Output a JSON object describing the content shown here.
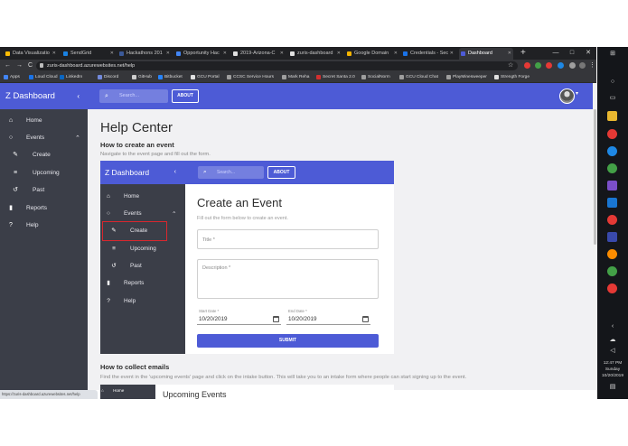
{
  "browser": {
    "tabs": [
      {
        "label": "Data Visualizatio",
        "color": "#fbbc04"
      },
      {
        "label": "SendGrid",
        "color": "#1a82e2"
      },
      {
        "label": "Hackathons 201",
        "color": "#3b5998"
      },
      {
        "label": "Opportunity Hac",
        "color": "#4285f4"
      },
      {
        "label": "2019-Arizona-C",
        "color": "#e0e0e0"
      },
      {
        "label": "zuris-dashboard",
        "color": "#e0e0e0"
      },
      {
        "label": "Google Domain",
        "color": "#f4b400"
      },
      {
        "label": "Credentials - Sec",
        "color": "#1a73e8"
      },
      {
        "label": "Dashboard",
        "color": "#4d5bd6"
      }
    ],
    "new_tab": "+",
    "window_controls": {
      "minimize": "—",
      "maximize": "□",
      "close": "✕"
    },
    "nav": {
      "back": "←",
      "forward": "→",
      "reload": "C"
    },
    "url": "zuris-dashboard.azurewebsites.net/help",
    "star": "☆",
    "menu": "⋮",
    "bookmarks": [
      {
        "label": "Apps",
        "color": "#4285f4"
      },
      {
        "label": "Loud Cloud",
        "color": "#1a73e8"
      },
      {
        "label": "LinkedIn",
        "color": "#0a66c2"
      },
      {
        "label": "Discord",
        "color": "#7289da"
      },
      {
        "label": "GitHub",
        "color": "#cccccc"
      },
      {
        "label": "Bitbucket",
        "color": "#2684ff"
      },
      {
        "label": "GCU Portal",
        "color": "#e0e0e0"
      },
      {
        "label": "CCSC Service Hours",
        "color": "#9e9e9e"
      },
      {
        "label": "Mark Reha",
        "color": "#9e9e9e"
      },
      {
        "label": "Secret Santa 2.0",
        "color": "#d32f2f"
      },
      {
        "label": "SocialNorm",
        "color": "#9e9e9e"
      },
      {
        "label": "GCU Cloud Chat",
        "color": "#9e9e9e"
      },
      {
        "label": "PlayMinesweeper",
        "color": "#9e9e9e"
      },
      {
        "label": "Strength Forge",
        "color": "#e0e0e0"
      }
    ],
    "status_url": "https://zuris-dashboard.azurewebsites.net/help"
  },
  "app": {
    "brand": "Z Dashboard",
    "collapse_icon": "‹",
    "search_placeholder": "Search...",
    "about_label": "ABOUT",
    "nav": [
      {
        "label": "Home",
        "icon": "home-icon",
        "glyph": "⌂"
      },
      {
        "label": "Events",
        "icon": "events-circle-icon",
        "glyph": "○",
        "expand": "⌃"
      },
      {
        "label": "Create",
        "icon": "pencil-icon",
        "glyph": "✎"
      },
      {
        "label": "Upcoming",
        "icon": "list-icon",
        "glyph": "≡"
      },
      {
        "label": "Past",
        "icon": "history-icon",
        "glyph": "↺"
      },
      {
        "label": "Reports",
        "icon": "bar-chart-icon",
        "glyph": "▮"
      },
      {
        "label": "Help",
        "icon": "help-icon",
        "glyph": "?"
      }
    ]
  },
  "help": {
    "title": "Help Center",
    "sections": [
      {
        "heading": "How to create an event",
        "text": "Navigate to the event page and fill out the form."
      },
      {
        "heading": "How to collect emails",
        "text": "Find the event in the 'upcoming events' page and click on the intake button. This will take you to an intake form where people can start signing up to the event."
      }
    ]
  },
  "inner": {
    "form_title": "Create an Event",
    "form_subtitle": "Fill out the form below to create an event.",
    "title_placeholder": "Title *",
    "description_placeholder": "Description *",
    "start_label": "Start Date *",
    "start_value": "10/20/2019",
    "end_label": "End Date *",
    "end_value": "10/20/2019",
    "submit_label": "SUBMIT",
    "highlight_color": "#d9272e"
  },
  "inner2": {
    "home_label": "Home",
    "title": "Upcoming Events"
  },
  "taskbar": {
    "time": "12:47 PM",
    "day": "Sunday",
    "date": "10/20/2019"
  },
  "colors": {
    "primary": "#4d5bd6",
    "sidebar": "#3b3e48",
    "content_bg": "#f1f1f3"
  }
}
